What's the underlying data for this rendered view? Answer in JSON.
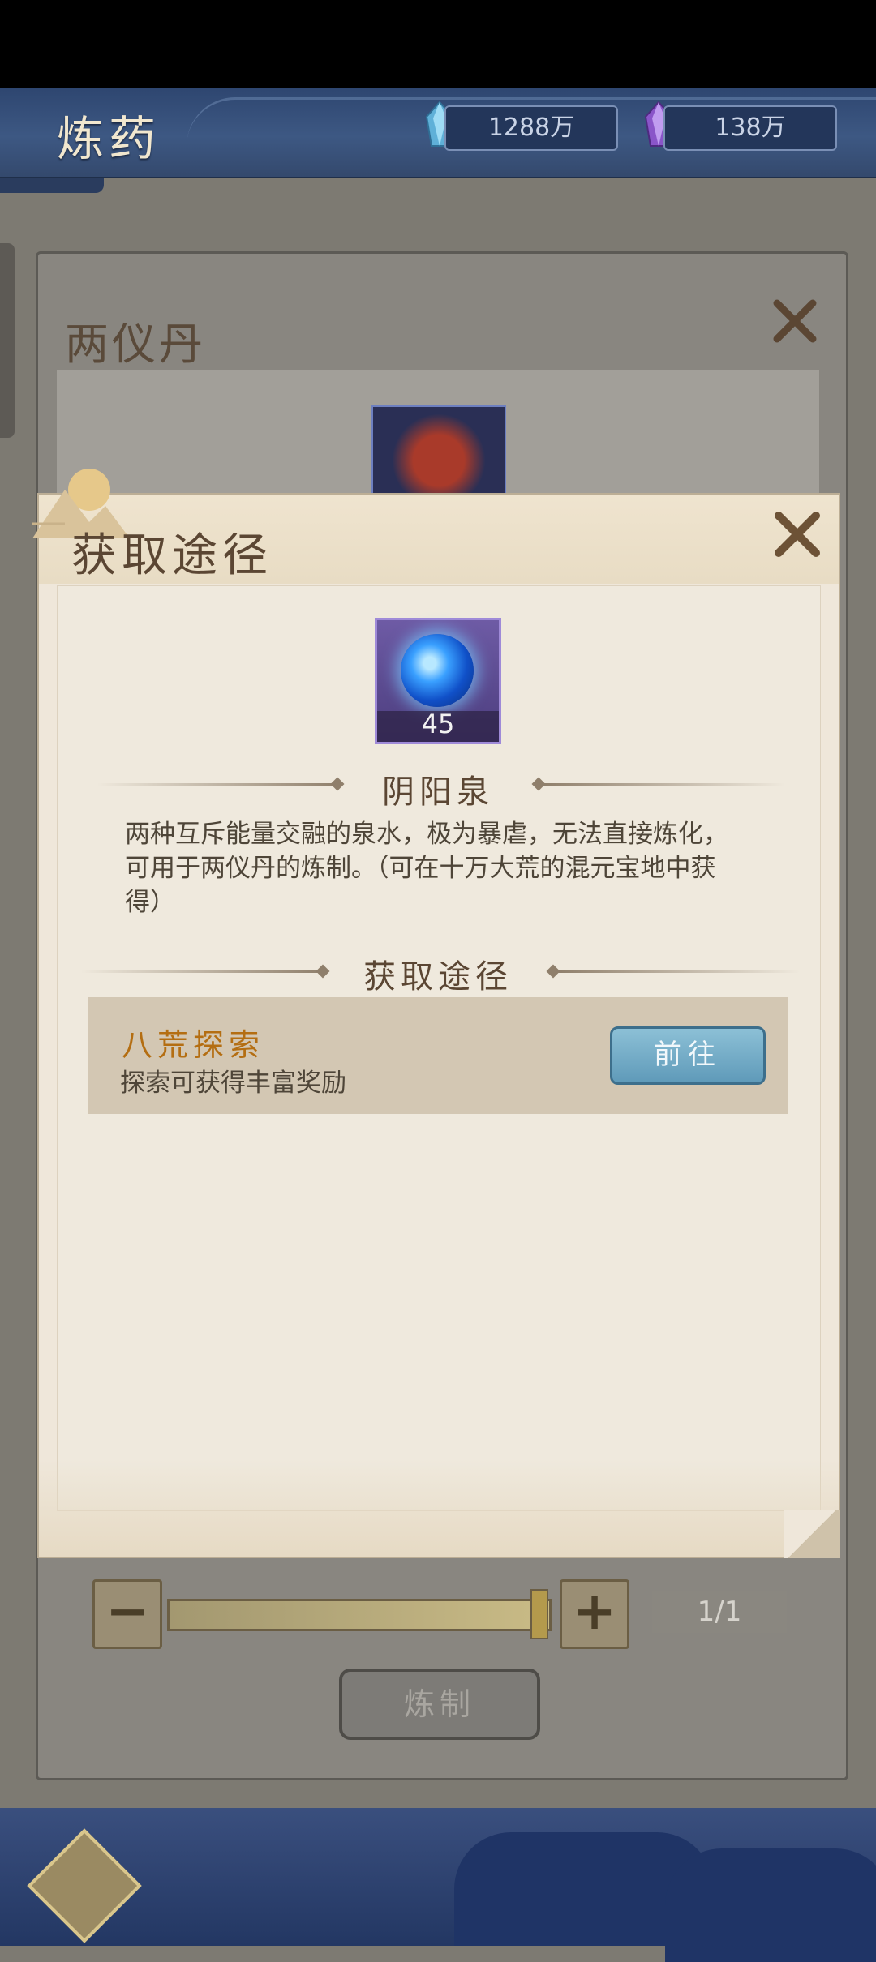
{
  "header": {
    "title": "炼药",
    "currency": [
      {
        "icon": "blue-crystal-icon",
        "value": "1288万"
      },
      {
        "icon": "purple-crystal-icon",
        "value": "138万"
      }
    ]
  },
  "background_panel": {
    "title": "两仪丹",
    "quantity_value": "1/1",
    "refine_button": "炼制",
    "minus_label": "−",
    "plus_label": "+"
  },
  "dialog": {
    "title": "获取途径",
    "item": {
      "name": "阴阳泉",
      "count": "45",
      "icon": "yin-yang-spring-orb-icon",
      "description": "两种互斥能量交融的泉水，极为暴虐，无法直接炼化，可用于两仪丹的炼制。（可在十万大荒的混元宝地中获得）"
    },
    "sources_heading": "获取途径",
    "sources": [
      {
        "name": "八荒探索",
        "description": "探索可获得丰富奖励",
        "button": "前往"
      }
    ]
  },
  "colors": {
    "topbar": "#3d5883",
    "dialog_bg": "#efe7da",
    "source_name": "#b46e12",
    "goto_button": "#6fa8c6"
  }
}
